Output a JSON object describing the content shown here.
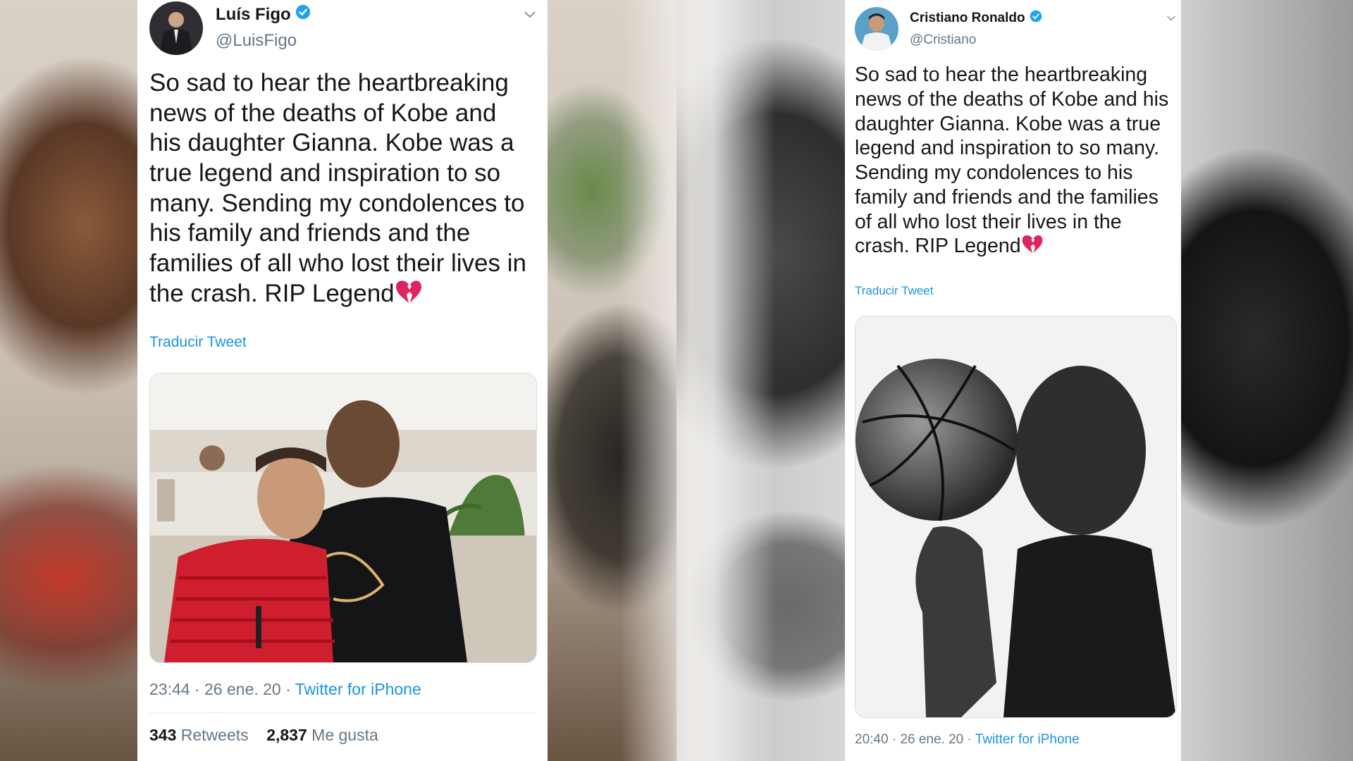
{
  "colors": {
    "link": "#1b95e0",
    "secondary_text": "#657786",
    "verified": "#1da1f2",
    "broken_heart": "#e0245e"
  },
  "tweets": [
    {
      "display_name": "Luís Figo",
      "handle": "@LuisFigo",
      "text": "So sad to hear the heartbreaking news of the deaths of Kobe and his daughter Gianna. Kobe was a true legend and inspiration to so many. Sending my condolences to his family and friends and the families of all who lost their lives in the crash. RIP Legend",
      "emoji": "broken-heart",
      "translate_label": "Traducir Tweet",
      "time": "23:44",
      "date": "26 ene. 20",
      "source": "Twitter for iPhone",
      "retweets_count": "343",
      "retweets_label": "Retweets",
      "likes_count": "2,837",
      "likes_label": "Me gusta"
    },
    {
      "display_name": "Cristiano Ronaldo",
      "handle": "@Cristiano",
      "text": "So sad to hear the heartbreaking news of the deaths of Kobe and his daughter Gianna. Kobe was a true legend and inspiration to so many. Sending my condolences to his family and friends and the families of all who lost their lives in the crash. RIP Legend",
      "emoji": "broken-heart",
      "translate_label": "Traducir Tweet",
      "time": "20:40",
      "date": "26 ene. 20",
      "source": "Twitter for iPhone"
    }
  ]
}
